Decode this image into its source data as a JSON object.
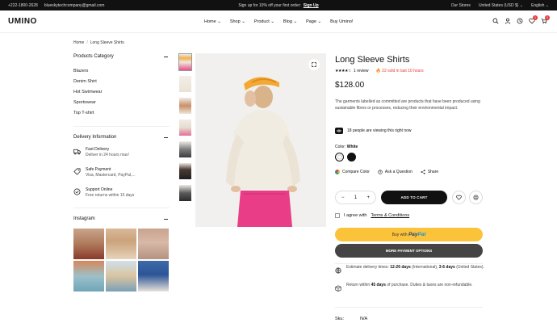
{
  "topbar": {
    "phone": "+222-1800-2628",
    "email": "blueskytechcompany@gmail.com",
    "promo": "Sign up for 10% off your first order:",
    "signup": "Sign Up",
    "stores": "Our Stores",
    "currency": "United States (USD $)",
    "language": "English"
  },
  "header": {
    "logo": "UMINO",
    "nav": [
      "Home",
      "Shop",
      "Product",
      "Blog",
      "Page",
      "Buy Umino!"
    ],
    "wishlist_count": "1",
    "cart_count": "0"
  },
  "breadcrumb": {
    "home": "Home",
    "current": "Long Sleeve Shirts"
  },
  "sidebar": {
    "category_title": "Products Category",
    "categories": [
      "Blazers",
      "Denim Shirt",
      "Hot Swimwear",
      "Sportswear",
      "Top T-shirt"
    ],
    "delivery_title": "Delivery Information",
    "delivery": [
      {
        "title": "Fast Delivery",
        "sub": "Deliver in 24 hours max!"
      },
      {
        "title": "Safe Payment",
        "sub": "Visa, Mastercard, PayPal,..."
      },
      {
        "title": "Support Online",
        "sub": "Free returns within 15 days"
      }
    ],
    "instagram_title": "Instagram"
  },
  "product": {
    "title": "Long Sleeve Shirts",
    "reviews": "1 review",
    "sold": "22 sold in last 10 hours",
    "rating": 4,
    "price": "$128.00",
    "description": "The garments labelled as committed are products that have been produced using sustainable fibres or processes, reducing their environmental impact.",
    "viewing": "18 people are viewing this right now",
    "color_label": "Color:",
    "color_value": "White",
    "compare": "Compare Color",
    "ask": "Ask a Question",
    "share": "Share",
    "qty": "1",
    "add_to_cart": "ADD TO CART",
    "agree_text": "I agree with",
    "terms": "Terms & Conditions",
    "paypal_prefix": "Buy with",
    "paypal_brand_a": "Pay",
    "paypal_brand_b": "Pal",
    "more_payment": "MORE PAYMENT OPTIONS",
    "delivery_est": {
      "pre": "Estimate delivery times:",
      "intl": "12-26 days",
      "mid": "(International),",
      "us": "3-6 days",
      "post": "(United States)."
    },
    "returns": {
      "pre": "Return within",
      "days": "45 days",
      "post": "of purchase. Duties & taxes are non-refundable."
    },
    "sku_label": "Sku:",
    "sku_value": "N/A"
  },
  "colors": {
    "accent_red": "#e53935",
    "paypal_yellow": "#fbc33a",
    "dark": "#111111"
  }
}
